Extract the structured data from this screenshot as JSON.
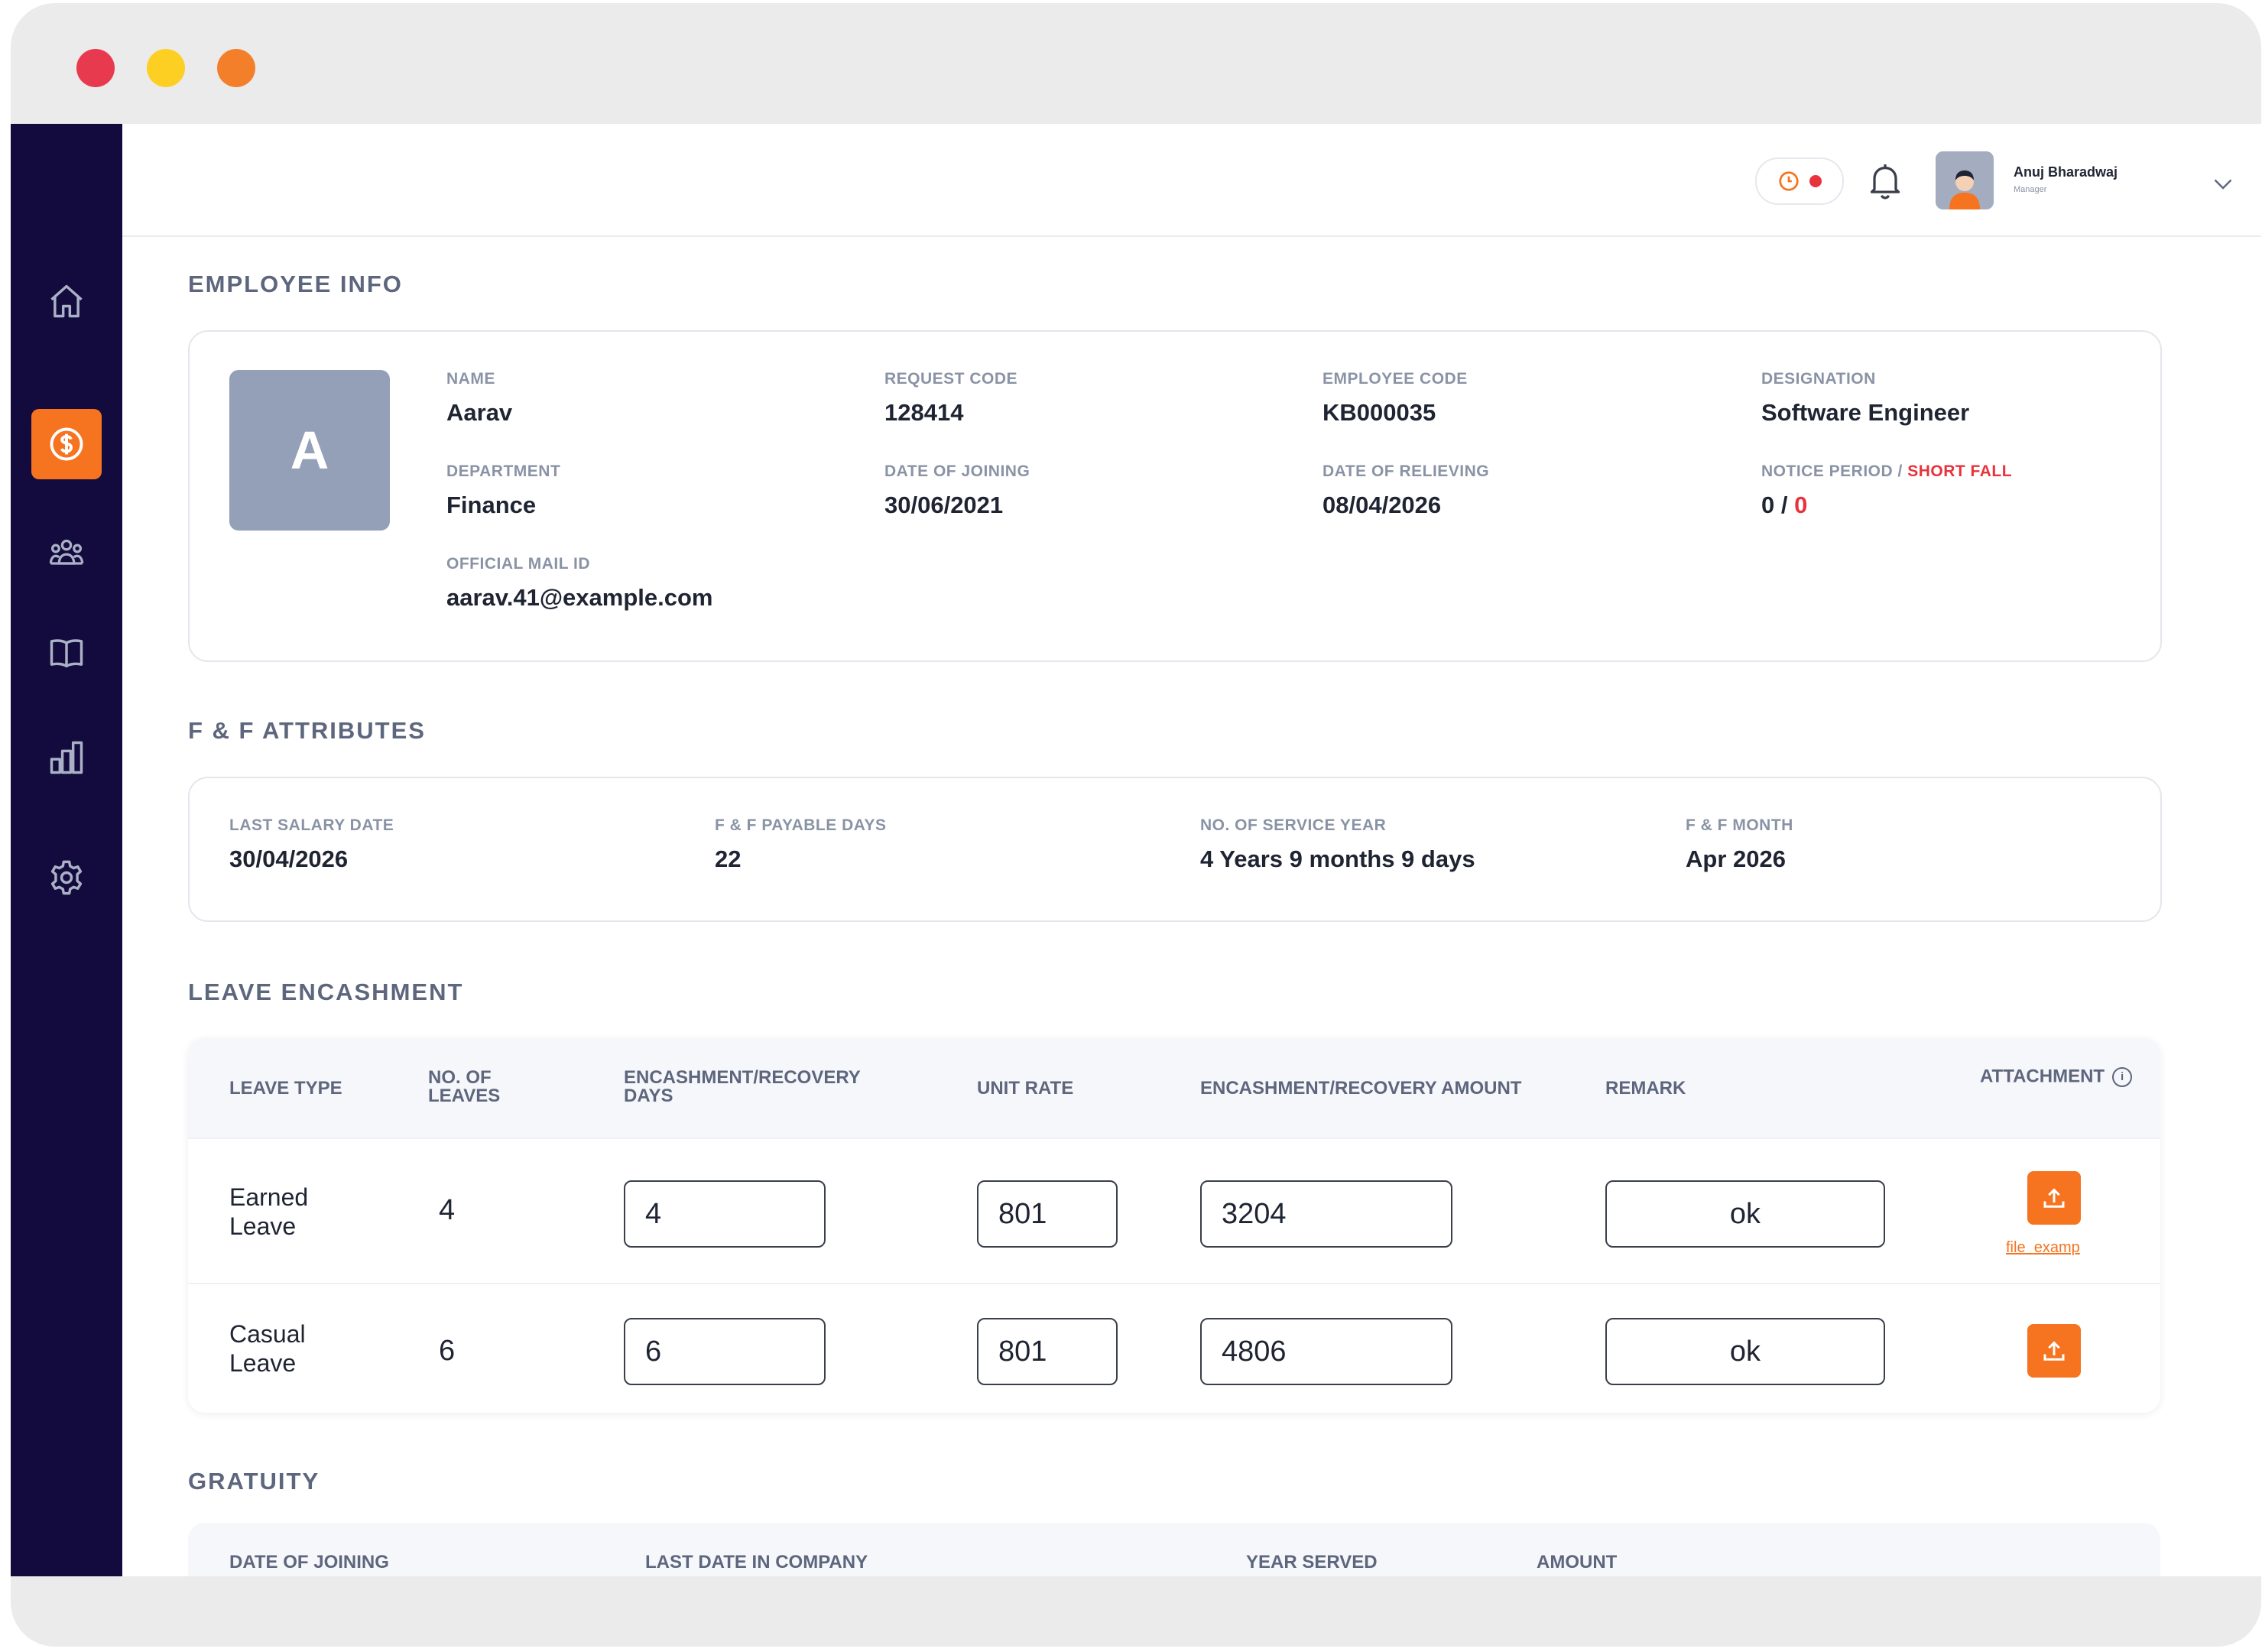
{
  "window": {
    "controls": [
      "close",
      "minimize",
      "maximize"
    ]
  },
  "sidebar": {
    "items": [
      {
        "icon": "home-icon",
        "active": false
      },
      {
        "icon": "dollar-icon",
        "active": true
      },
      {
        "icon": "team-icon",
        "active": false
      },
      {
        "icon": "book-icon",
        "active": false
      },
      {
        "icon": "bar-chart-icon",
        "active": false
      },
      {
        "icon": "gear-icon",
        "active": false
      }
    ]
  },
  "header": {
    "user": {
      "name": "Anuj Bharadwaj",
      "role": "Manager"
    }
  },
  "employee_info": {
    "title": "EMPLOYEE INFO",
    "avatar_letter": "A",
    "fields": {
      "name": {
        "label": "NAME",
        "value": "Aarav"
      },
      "request_code": {
        "label": "REQUEST CODE",
        "value": "128414"
      },
      "employee_code": {
        "label": "EMPLOYEE CODE",
        "value": "KB000035"
      },
      "designation": {
        "label": "DESIGNATION",
        "value": "Software Engineer"
      },
      "department": {
        "label": "DEPARTMENT",
        "value": "Finance"
      },
      "date_of_joining": {
        "label": "DATE OF JOINING",
        "value": "30/06/2021"
      },
      "date_of_relieving": {
        "label": "DATE OF RELIEVING",
        "value": "08/04/2026"
      },
      "notice_period": {
        "label": "NOTICE PERIOD /",
        "label_red": "SHORT FALL",
        "value": "0 /",
        "value_red": "0"
      },
      "official_mail": {
        "label": "OFFICIAL MAIL ID",
        "value": "aarav.41@example.com"
      }
    }
  },
  "ff_attributes": {
    "title": "F & F ATTRIBUTES",
    "fields": {
      "last_salary_date": {
        "label": "LAST SALARY DATE",
        "value": "30/04/2026"
      },
      "payable_days": {
        "label": "F & F PAYABLE DAYS",
        "value": "22"
      },
      "service_year": {
        "label": "NO. OF SERVICE YEAR",
        "value": "4 Years 9 months 9 days"
      },
      "ff_month": {
        "label": "F & F MONTH",
        "value": "Apr 2026"
      }
    }
  },
  "leave_encashment": {
    "title": "LEAVE ENCASHMENT",
    "headers": {
      "leave_type": "LEAVE TYPE",
      "no_of_leaves_1": "NO. OF",
      "no_of_leaves_2": "LEAVES",
      "enc_days_1": "ENCASHMENT/RECOVERY",
      "enc_days_2": "DAYS",
      "unit_rate": "UNIT RATE",
      "enc_amount": "ENCASHMENT/RECOVERY AMOUNT",
      "remark": "REMARK",
      "attachment": "ATTACHMENT"
    },
    "rows": [
      {
        "type_1": "Earned",
        "type_2": "Leave",
        "leaves": "4",
        "days": "4",
        "unit_rate": "801",
        "amount": "3204",
        "remark": "ok",
        "file_link_1": "file",
        "file_link_2": "examp"
      },
      {
        "type_1": "Casual",
        "type_2": "Leave",
        "leaves": "6",
        "days": "6",
        "unit_rate": "801",
        "amount": "4806",
        "remark": "ok"
      }
    ]
  },
  "gratuity": {
    "title": "GRATUITY",
    "headers": {
      "date_of_joining": "DATE OF JOINING",
      "last_date": "LAST DATE IN COMPANY",
      "year_served": "YEAR SERVED",
      "amount": "AMOUNT"
    }
  },
  "colors": {
    "accent": "#f6731f",
    "sidebar": "#130a3d",
    "danger": "#e8323c"
  }
}
